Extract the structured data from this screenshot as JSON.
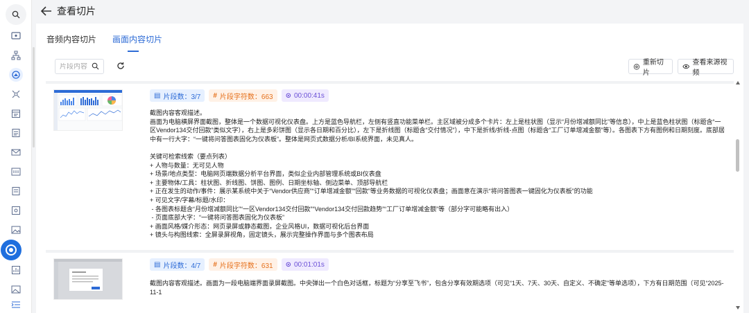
{
  "header": {
    "title": "查看切片"
  },
  "tabs": [
    {
      "label": "音频内容切片"
    },
    {
      "label": "画面内容切片"
    }
  ],
  "search": {
    "placeholder": "片段内容"
  },
  "toolbar": {
    "recut_label": "重新切片",
    "view_source_label": "查看来源视频"
  },
  "items": [
    {
      "segment_count": "片段数：3/7",
      "char_count": "片段字符数：663",
      "duration": "00:00:41s",
      "description": "截图内容客观描述。\n画面为电脑横屏界面截图，整体是一个数据可视化仪表盘。上方是蓝色导航栏，左侧有竖直功能菜单栏。主区域被分成多个卡片：左上是柱状图（显示“月份增减额同比”等信息），中上是蓝色柱状图（标题含“一区Vendor134交付回款”类似文字），右上是多彩饼图（显示各日期和百分比），左下是折线图（标题含“交付情况”），中下是折线/折线-点图（标题含“工厂订单增减金额”等）。各图表下方有图例和日期刻度。底部居中有一行大字：“一键将问答图表固化为仪表板”。整体是网页式数据分析/BI系统界面，未见真人。\n\n关键可检索线索（要点列表）\n+ 人物与数量：无可见人物\n+ 场景/地点类型：电脑网页端数据分析平台界面，类似企业内部管理系统或BI仪表盘\n+ 主要物体/工具：柱状图、折线图、饼图、图例、日期坐标轴、侧边菜单、顶部导航栏\n+ 正在发生的动作/事件：展示某系统中关于“Vendor供应商”“订单增减金额”“回款”等业务数据的可视化仪表盘；画面意在演示“将问答图表一键固化为仪表板”的功能\n+ 可见文字/字幕/标题/水印：\n - 各图表标题含“月份增减额同比”“一区Vendor134交付回款”“Vendor134交付回款趋势”“工厂订单增减金额”等（部分字可能略有出入）\n - 页面底部大字：“一键将问答图表固化为仪表板”\n+ 画面风格/媒介形态：网页录屏或静态截图，企业风格UI，数据可视化后台界面\n+ 镜头与构图线索：全屏录屏视角，固定镜头，展示完整操作界面与多个图表布局",
      "thumb_caption": "一键将问答图表固化为仪表板"
    },
    {
      "segment_count": "片段数：4/7",
      "char_count": "片段字符数：631",
      "duration": "00:01:01s",
      "description": "截图内容客观描述。画面为一段电脑端界面录屏截图。中央弹出一个白色对话框，标题为“分享至飞书”，包含分享有效期选项（可见“1天、7天、30天、自定义、不确定”等单选项），下方有日期范围（可见“2025-11-1"
    }
  ]
}
